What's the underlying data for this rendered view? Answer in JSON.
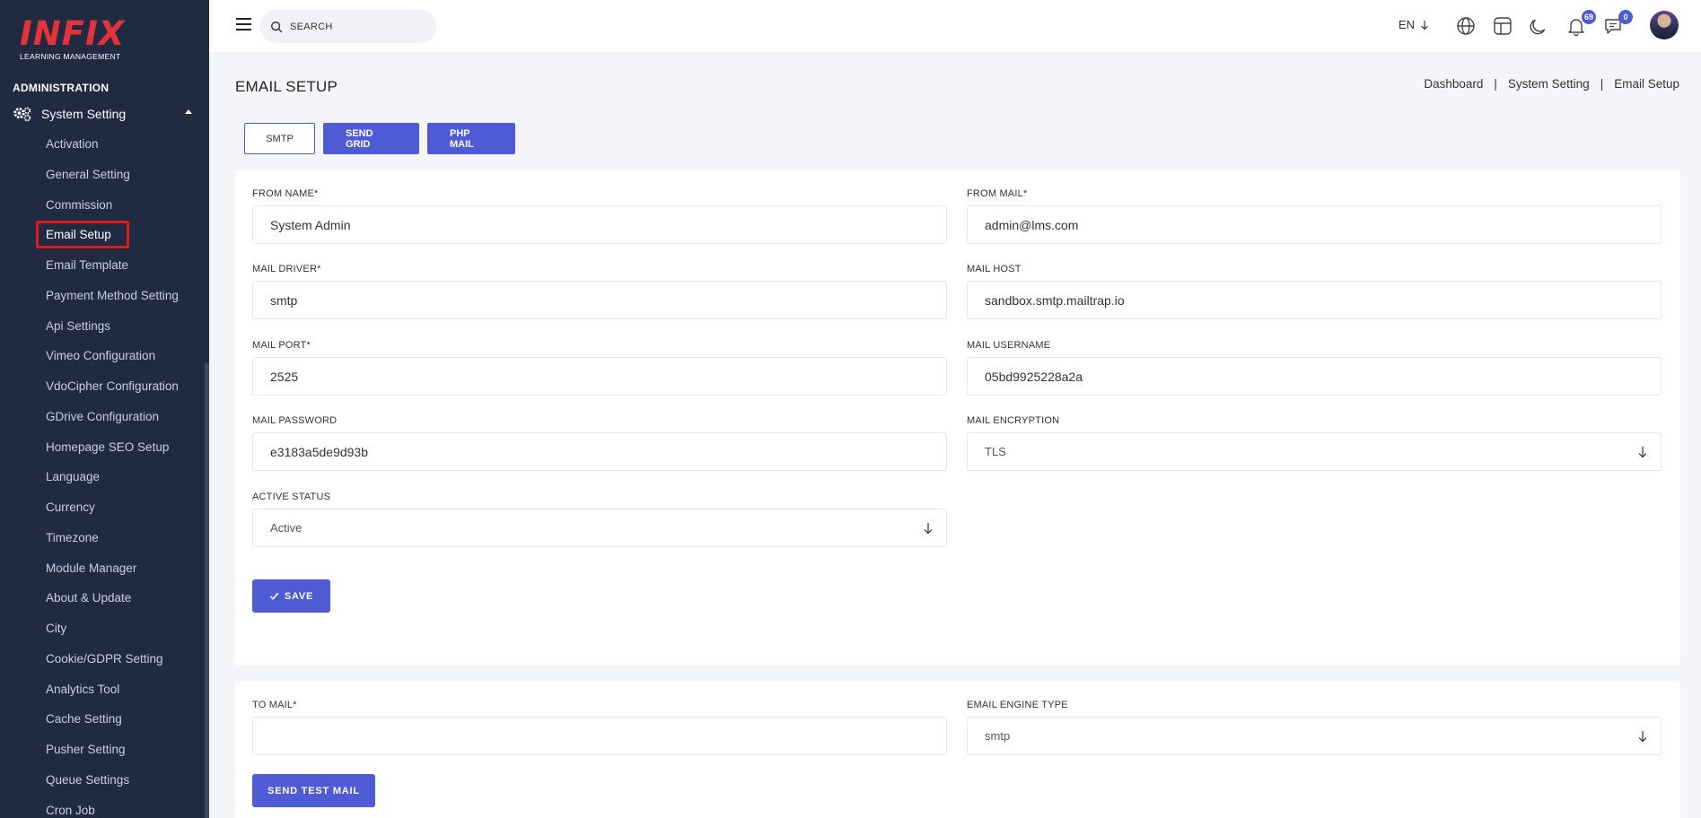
{
  "logo": {
    "brand": "INFIX",
    "tagline": "LEARNING MANAGEMENT"
  },
  "sidebar": {
    "section": "ADMINISTRATION",
    "parent": "System Setting",
    "items": [
      "Activation",
      "General Setting",
      "Commission",
      "Email Setup",
      "Email Template",
      "Payment Method Setting",
      "Api Settings",
      "Vimeo Configuration",
      "VdoCipher Configuration",
      "GDrive Configuration",
      "Homepage SEO Setup",
      "Language",
      "Currency",
      "Timezone",
      "Module Manager",
      "About & Update",
      "City",
      "Cookie/GDPR Setting",
      "Analytics Tool",
      "Cache Setting",
      "Pusher Setting",
      "Queue Settings",
      "Cron Job"
    ],
    "active_item": "Email Setup"
  },
  "header": {
    "search_placeholder": "SEARCH",
    "language": "EN",
    "notifications_count": "69",
    "messages_count": "0"
  },
  "page": {
    "title": "EMAIL SETUP",
    "breadcrumb": [
      "Dashboard",
      "System Setting",
      "Email Setup"
    ],
    "breadcrumb_sep": "|"
  },
  "tabs": [
    "SMTP",
    "SEND GRID",
    "PHP MAIL"
  ],
  "form": {
    "from_name": {
      "label": "FROM NAME*",
      "value": "System Admin"
    },
    "from_mail": {
      "label": "FROM MAIL*",
      "value": "admin@lms.com"
    },
    "mail_driver": {
      "label": "MAIL DRIVER*",
      "value": "smtp"
    },
    "mail_host": {
      "label": "MAIL HOST",
      "value": "sandbox.smtp.mailtrap.io"
    },
    "mail_port": {
      "label": "MAIL PORT*",
      "value": "2525"
    },
    "mail_username": {
      "label": "MAIL USERNAME",
      "value": "05bd9925228a2a"
    },
    "mail_password": {
      "label": "MAIL PASSWORD",
      "value": "e3183a5de9d93b"
    },
    "mail_encryption": {
      "label": "MAIL ENCRYPTION",
      "value": "TLS"
    },
    "active_status": {
      "label": "ACTIVE STATUS",
      "value": "Active"
    },
    "save_label": "SAVE"
  },
  "test": {
    "to_mail": {
      "label": "TO MAIL*",
      "value": ""
    },
    "engine": {
      "label": "EMAIL ENGINE TYPE",
      "value": "smtp"
    },
    "send_label": "SEND TEST MAIL"
  },
  "colors": {
    "sidebar_bg": "#202b41",
    "accent": "#4f5bd5",
    "logo_red": "#e3323b",
    "active_outline": "#e01818"
  }
}
